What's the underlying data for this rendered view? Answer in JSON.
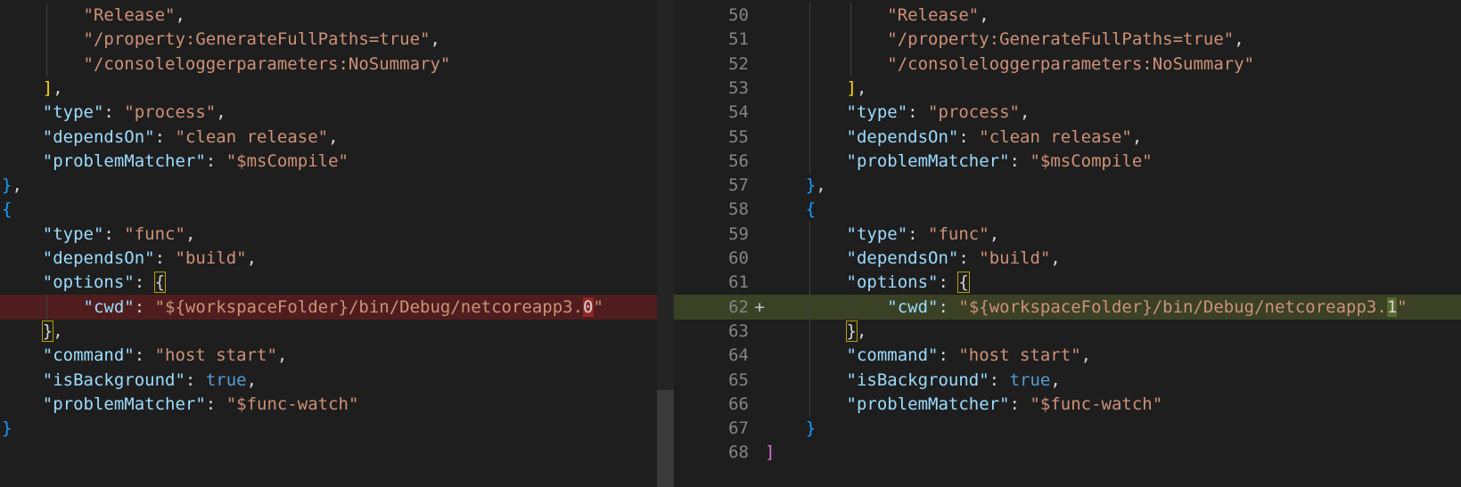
{
  "left": {
    "lines": [
      {
        "indent": 2,
        "tokens": [
          [
            "s",
            "\"Release\""
          ],
          [
            "p",
            ","
          ]
        ]
      },
      {
        "indent": 2,
        "tokens": [
          [
            "s",
            "\"/property:GenerateFullPaths=true\""
          ],
          [
            "p",
            ","
          ]
        ]
      },
      {
        "indent": 2,
        "tokens": [
          [
            "s",
            "\"/consoleloggerparameters:NoSummary\""
          ]
        ]
      },
      {
        "indent": 1,
        "tokens": [
          [
            "b",
            "]"
          ],
          [
            "p",
            ","
          ]
        ]
      },
      {
        "indent": 1,
        "tokens": [
          [
            "k",
            "\"type\""
          ],
          [
            "p",
            ": "
          ],
          [
            "s",
            "\"process\""
          ],
          [
            "p",
            ","
          ]
        ]
      },
      {
        "indent": 1,
        "tokens": [
          [
            "k",
            "\"dependsOn\""
          ],
          [
            "p",
            ": "
          ],
          [
            "s",
            "\"clean release\""
          ],
          [
            "p",
            ","
          ]
        ]
      },
      {
        "indent": 1,
        "tokens": [
          [
            "k",
            "\"problemMatcher\""
          ],
          [
            "p",
            ": "
          ],
          [
            "s",
            "\"$msCompile\""
          ]
        ]
      },
      {
        "indent": 0,
        "tokens": [
          [
            "b3",
            "}"
          ],
          [
            "p",
            ","
          ]
        ]
      },
      {
        "indent": 0,
        "tokens": [
          [
            "b3",
            "{"
          ]
        ]
      },
      {
        "indent": 1,
        "tokens": [
          [
            "k",
            "\"type\""
          ],
          [
            "p",
            ": "
          ],
          [
            "s",
            "\"func\""
          ],
          [
            "p",
            ","
          ]
        ]
      },
      {
        "indent": 1,
        "tokens": [
          [
            "k",
            "\"dependsOn\""
          ],
          [
            "p",
            ": "
          ],
          [
            "s",
            "\"build\""
          ],
          [
            "p",
            ","
          ]
        ]
      },
      {
        "indent": 1,
        "tokens": [
          [
            "k",
            "\"options\""
          ],
          [
            "p",
            ": "
          ],
          [
            "bm",
            "{"
          ]
        ]
      },
      {
        "indent": 2,
        "diff": "removed",
        "tokens": [
          [
            "k",
            "\"cwd\""
          ],
          [
            "p",
            ": "
          ],
          [
            "s",
            "\"${workspaceFolder}/bin/Debug/netcoreapp3."
          ],
          [
            "hl",
            "0"
          ],
          [
            "s",
            "\""
          ]
        ]
      },
      {
        "indent": 1,
        "tokens": [
          [
            "bm",
            "}"
          ],
          [
            "p",
            ","
          ]
        ]
      },
      {
        "indent": 1,
        "tokens": [
          [
            "k",
            "\"command\""
          ],
          [
            "p",
            ": "
          ],
          [
            "s",
            "\"host start\""
          ],
          [
            "p",
            ","
          ]
        ]
      },
      {
        "indent": 1,
        "tokens": [
          [
            "k",
            "\"isBackground\""
          ],
          [
            "p",
            ": "
          ],
          [
            "kw",
            "true"
          ],
          [
            "p",
            ","
          ]
        ]
      },
      {
        "indent": 1,
        "tokens": [
          [
            "k",
            "\"problemMatcher\""
          ],
          [
            "p",
            ": "
          ],
          [
            "s",
            "\"$func-watch\""
          ]
        ]
      },
      {
        "indent": 0,
        "tokens": [
          [
            "b3",
            "}"
          ]
        ]
      },
      {
        "indent": 0,
        "tokens": []
      }
    ]
  },
  "right": {
    "lines": [
      {
        "num": "50",
        "indent": 3,
        "tokens": [
          [
            "s",
            "\"Release\""
          ],
          [
            "p",
            ","
          ]
        ]
      },
      {
        "num": "51",
        "indent": 3,
        "tokens": [
          [
            "s",
            "\"/property:GenerateFullPaths=true\""
          ],
          [
            "p",
            ","
          ]
        ]
      },
      {
        "num": "52",
        "indent": 3,
        "tokens": [
          [
            "s",
            "\"/consoleloggerparameters:NoSummary\""
          ]
        ]
      },
      {
        "num": "53",
        "indent": 2,
        "tokens": [
          [
            "b",
            "]"
          ],
          [
            "p",
            ","
          ]
        ]
      },
      {
        "num": "54",
        "indent": 2,
        "tokens": [
          [
            "k",
            "\"type\""
          ],
          [
            "p",
            ": "
          ],
          [
            "s",
            "\"process\""
          ],
          [
            "p",
            ","
          ]
        ]
      },
      {
        "num": "55",
        "indent": 2,
        "tokens": [
          [
            "k",
            "\"dependsOn\""
          ],
          [
            "p",
            ": "
          ],
          [
            "s",
            "\"clean release\""
          ],
          [
            "p",
            ","
          ]
        ]
      },
      {
        "num": "56",
        "indent": 2,
        "tokens": [
          [
            "k",
            "\"problemMatcher\""
          ],
          [
            "p",
            ": "
          ],
          [
            "s",
            "\"$msCompile\""
          ]
        ]
      },
      {
        "num": "57",
        "indent": 1,
        "tokens": [
          [
            "b3",
            "}"
          ],
          [
            "p",
            ","
          ]
        ]
      },
      {
        "num": "58",
        "indent": 1,
        "tokens": [
          [
            "b3",
            "{"
          ]
        ]
      },
      {
        "num": "59",
        "indent": 2,
        "tokens": [
          [
            "k",
            "\"type\""
          ],
          [
            "p",
            ": "
          ],
          [
            "s",
            "\"func\""
          ],
          [
            "p",
            ","
          ]
        ]
      },
      {
        "num": "60",
        "indent": 2,
        "tokens": [
          [
            "k",
            "\"dependsOn\""
          ],
          [
            "p",
            ": "
          ],
          [
            "s",
            "\"build\""
          ],
          [
            "p",
            ","
          ]
        ]
      },
      {
        "num": "61",
        "indent": 2,
        "tokens": [
          [
            "k",
            "\"options\""
          ],
          [
            "p",
            ": "
          ],
          [
            "bm",
            "{"
          ]
        ]
      },
      {
        "num": "62",
        "mark": "+",
        "indent": 3,
        "diff": "added",
        "tokens": [
          [
            "k",
            "\"cwd\""
          ],
          [
            "p",
            ": "
          ],
          [
            "s",
            "\"${workspaceFolder}/bin/Debug/netcoreapp3."
          ],
          [
            "hl",
            "1"
          ],
          [
            "s",
            "\""
          ]
        ]
      },
      {
        "num": "63",
        "indent": 2,
        "tokens": [
          [
            "bm",
            "}"
          ],
          [
            "p",
            ","
          ]
        ]
      },
      {
        "num": "64",
        "indent": 2,
        "tokens": [
          [
            "k",
            "\"command\""
          ],
          [
            "p",
            ": "
          ],
          [
            "s",
            "\"host start\""
          ],
          [
            "p",
            ","
          ]
        ]
      },
      {
        "num": "65",
        "indent": 2,
        "tokens": [
          [
            "k",
            "\"isBackground\""
          ],
          [
            "p",
            ": "
          ],
          [
            "kw",
            "true"
          ],
          [
            "p",
            ","
          ]
        ]
      },
      {
        "num": "66",
        "indent": 2,
        "tokens": [
          [
            "k",
            "\"problemMatcher\""
          ],
          [
            "p",
            ": "
          ],
          [
            "s",
            "\"$func-watch\""
          ]
        ]
      },
      {
        "num": "67",
        "indent": 1,
        "tokens": [
          [
            "b3",
            "}"
          ]
        ]
      },
      {
        "num": "68",
        "indent": 0,
        "tokens": [
          [
            "b2",
            "]"
          ]
        ]
      }
    ]
  }
}
